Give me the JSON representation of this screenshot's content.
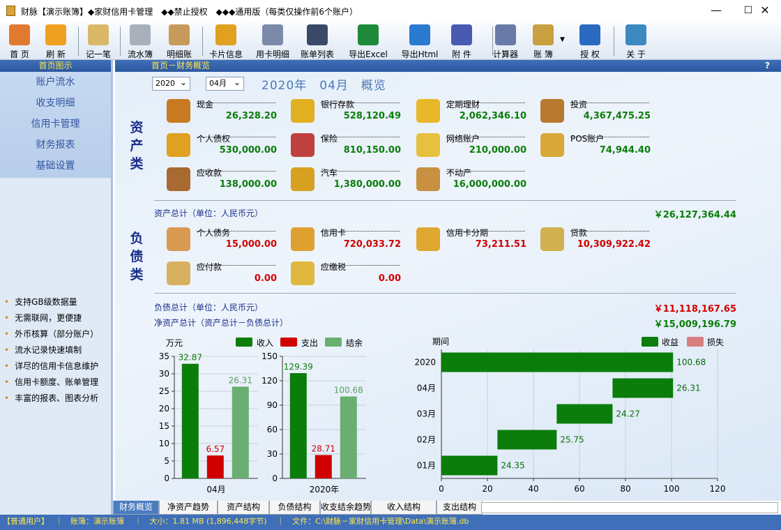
{
  "window": {
    "title": "财脉【演示账簿】◆家财信用卡管理　◆◆禁止授权　◆◆◆通用版（每类仅操作前6个账户）",
    "min": "—",
    "max": "☐",
    "close": "✕"
  },
  "toolbar": [
    {
      "label": "首 页",
      "icon": "home-icon",
      "color": "#e07a30"
    },
    {
      "label": "刷 新",
      "icon": "refresh-icon",
      "color": "#f0a020"
    },
    {
      "label": "记一笔",
      "icon": "pen-icon",
      "color": "#d9b86a"
    },
    {
      "label": "流水簿",
      "icon": "ledger-icon",
      "color": "#a8b0bc"
    },
    {
      "label": "明细账",
      "icon": "detail-icon",
      "color": "#c89a5a"
    },
    {
      "label": "卡片信息",
      "icon": "card-icon",
      "color": "#e0a020"
    },
    {
      "label": "用卡明细",
      "icon": "cards-icon",
      "color": "#7a8aa8"
    },
    {
      "label": "账单列表",
      "icon": "bill-list-icon",
      "color": "#3a4a66"
    },
    {
      "label": "导出Excel",
      "icon": "excel-icon",
      "color": "#1f8a3a"
    },
    {
      "label": "导出Html",
      "icon": "ie-icon",
      "color": "#2a7ad0"
    },
    {
      "label": "附 件",
      "icon": "attachment-icon",
      "color": "#4a5ab0"
    },
    {
      "label": "计算器",
      "icon": "calculator-icon",
      "color": "#6a7aa8"
    },
    {
      "label": "账 簿",
      "icon": "database-icon",
      "color": "#c8a040"
    },
    {
      "label": "授 权",
      "icon": "key-icon",
      "color": "#2a6ac0"
    },
    {
      "label": "关 于",
      "icon": "info-icon",
      "color": "#3a8ac0"
    }
  ],
  "left": {
    "header": "首页图示",
    "nav": [
      "账户流水",
      "收支明细",
      "信用卡管理",
      "财务报表",
      "基础设置"
    ],
    "features": [
      "支持GB级数据量",
      "无需联网，更便捷",
      "外币核算（部分账户）",
      "流水记录快速填制",
      "详尽的信用卡信息维护",
      "信用卡额度、账单管理",
      "丰富的报表、图表分析"
    ]
  },
  "main": {
    "header": "首页－财务概览",
    "help": "?",
    "year": "2020",
    "month": "04月",
    "title": "2020年　04月　概览",
    "assets_label": "资产类",
    "assets": [
      {
        "name": "现金",
        "value": "26,328.20",
        "icon": "cash-wallet-icon",
        "color": "#c87a20"
      },
      {
        "name": "银行存款",
        "value": "528,120.49",
        "icon": "bank-deposit-icon",
        "color": "#e0b020"
      },
      {
        "name": "定期理财",
        "value": "2,062,346.10",
        "icon": "fixed-finance-icon",
        "color": "#e8b828"
      },
      {
        "name": "投资",
        "value": "4,367,475.25",
        "icon": "investment-icon",
        "color": "#b87a30"
      },
      {
        "name": "个人债权",
        "value": "530,000.00",
        "icon": "personal-claim-icon",
        "color": "#e0a020"
      },
      {
        "name": "保险",
        "value": "810,150.00",
        "icon": "insurance-icon",
        "color": "#c04040"
      },
      {
        "name": "网络账户",
        "value": "210,000.00",
        "icon": "online-account-icon",
        "color": "#e8c040"
      },
      {
        "name": "POS账户",
        "value": "74,944.40",
        "icon": "pos-account-icon",
        "color": "#d8a838"
      },
      {
        "name": "应收款",
        "value": "138,000.00",
        "icon": "receivable-bag-icon",
        "color": "#a86a30"
      },
      {
        "name": "汽车",
        "value": "1,380,000.00",
        "icon": "car-icon",
        "color": "#d8a020"
      },
      {
        "name": "不动产",
        "value": "16,000,000.00",
        "icon": "real-estate-icon",
        "color": "#c89040"
      }
    ],
    "asset_total_label": "资产总计（单位：人民币元）",
    "asset_total": "￥26,127,364.44",
    "liab_label": "负债类",
    "liabilities": [
      {
        "name": "个人债务",
        "value": "15,000.00",
        "icon": "personal-debt-icon",
        "color": "#d89a50"
      },
      {
        "name": "信用卡",
        "value": "720,033.72",
        "icon": "credit-card-icon",
        "color": "#e0a030"
      },
      {
        "name": "信用卡分期",
        "value": "73,211.51",
        "icon": "installment-icon",
        "color": "#e0a830"
      },
      {
        "name": "贷款",
        "value": "10,309,922.42",
        "icon": "loan-icon",
        "color": "#d0b050"
      },
      {
        "name": "应付款",
        "value": "0.00",
        "icon": "payable-icon",
        "color": "#d8b060"
      },
      {
        "name": "应缴税",
        "value": "0.00",
        "icon": "tax-icon",
        "color": "#e0b840"
      }
    ],
    "liab_total_label": "负债总计（单位：人民币元）",
    "liab_total": "￥11,118,167.65",
    "net_label": "净资产总计（资产总计－负债总计）",
    "net_total": "￥15,009,196.79"
  },
  "chart_data": [
    {
      "type": "bar",
      "unit_label": "万元",
      "legend": [
        "收入",
        "支出",
        "结余"
      ],
      "colors": [
        "#0a7d0a",
        "#d00000",
        "#6aae72"
      ],
      "categories": [
        "04月"
      ],
      "series": [
        {
          "name": "收入",
          "values": [
            32.87
          ]
        },
        {
          "name": "支出",
          "values": [
            6.57
          ]
        },
        {
          "name": "结余",
          "values": [
            26.31
          ]
        }
      ],
      "ylim": [
        0,
        35
      ],
      "ticks": [
        0,
        5,
        10,
        15,
        20,
        25,
        30,
        35
      ]
    },
    {
      "type": "bar",
      "categories": [
        "2020年"
      ],
      "series": [
        {
          "name": "收入",
          "values": [
            129.39
          ]
        },
        {
          "name": "支出",
          "values": [
            28.71
          ]
        },
        {
          "name": "结余",
          "values": [
            100.68
          ]
        }
      ],
      "ylim": [
        0,
        150
      ],
      "ticks": [
        0,
        30,
        60,
        90,
        120,
        150
      ]
    },
    {
      "type": "bar",
      "orientation": "horizontal",
      "ylabel": "期间",
      "legend": [
        "收益",
        "损失"
      ],
      "colors": [
        "#0a7d0a",
        "#d88080"
      ],
      "categories": [
        "2020",
        "04月",
        "03月",
        "02月",
        "01月"
      ],
      "starts": [
        0,
        74.37,
        50.1,
        24.35,
        0
      ],
      "values": [
        100.68,
        26.31,
        24.27,
        25.75,
        24.35
      ],
      "xlim": [
        0,
        120
      ],
      "ticks": [
        0,
        20,
        40,
        60,
        80,
        100,
        120
      ]
    }
  ],
  "tabs": [
    "财务概览",
    "净资产趋势",
    "资产结构",
    "负债结构",
    "收支结余趋势",
    "收入结构",
    "支出结构"
  ],
  "status": "【普通用户】　 ｜　账簿：演示账簿　 ｜　大小：1.81 MB (1,896,448字节)　 ｜　文件：C:\\财脉－家财信用卡管理\\Data\\演示账簿.db"
}
